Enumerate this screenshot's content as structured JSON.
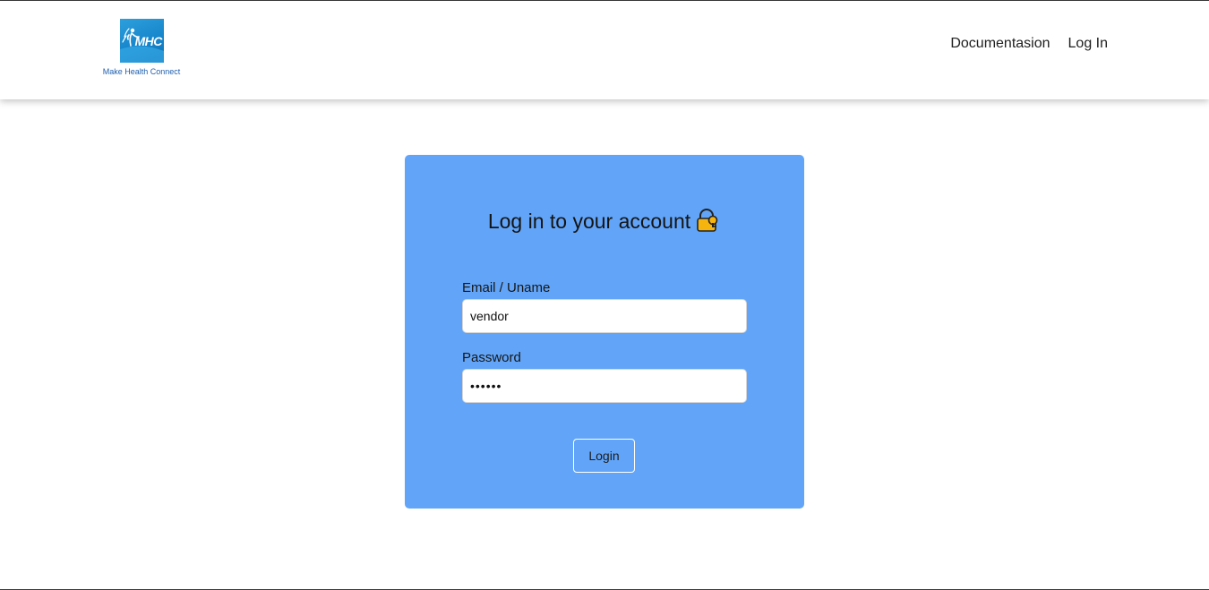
{
  "header": {
    "logo_text": "MHC",
    "brand_caption": "Make Health Connect",
    "nav": [
      {
        "label": "Documentasion"
      },
      {
        "label": "Log In"
      }
    ]
  },
  "login_card": {
    "title": "Log in to your account",
    "title_icon": "lock-icon",
    "email": {
      "label": "Email / Uname",
      "value": "vendor"
    },
    "password": {
      "label": "Password",
      "value": "••••••"
    },
    "submit_label": "Login"
  },
  "colors": {
    "card_background": "#62a5f8",
    "logo_blue": "#1583c9",
    "brand_caption": "#1f5fae",
    "lock_body": "#f6b40e"
  }
}
